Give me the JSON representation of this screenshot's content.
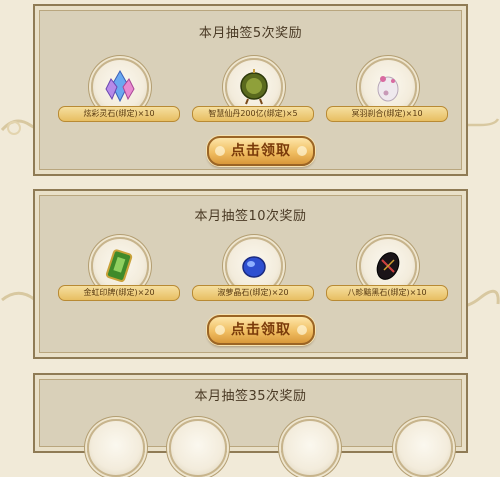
{
  "panels": [
    {
      "title": "本月抽签5次奖励",
      "button_label": "点击领取",
      "rewards": [
        {
          "label": "炫彩灵石(绑定)×10",
          "icon": "crystal-icon"
        },
        {
          "label": "智慧仙丹200亿(绑定)×5",
          "icon": "elixir-icon"
        },
        {
          "label": "冥羽刹合(绑定)×10",
          "icon": "pearl-icon"
        }
      ]
    },
    {
      "title": "本月抽签10次奖励",
      "button_label": "点击领取",
      "rewards": [
        {
          "label": "金虹印牌(绑定)×20",
          "icon": "jade-tablet-icon"
        },
        {
          "label": "淑萝晶石(绑定)×20",
          "icon": "blue-gem-icon"
        },
        {
          "label": "八畛黯黑石(绑定)×10",
          "icon": "black-stone-icon"
        }
      ]
    },
    {
      "title": "本月抽签35次奖励",
      "rewards": []
    }
  ],
  "colors": {
    "background": "#f1ead8",
    "panel": "#d9d0b9",
    "button": "#f0be62",
    "label_bg": "#e8be62"
  }
}
